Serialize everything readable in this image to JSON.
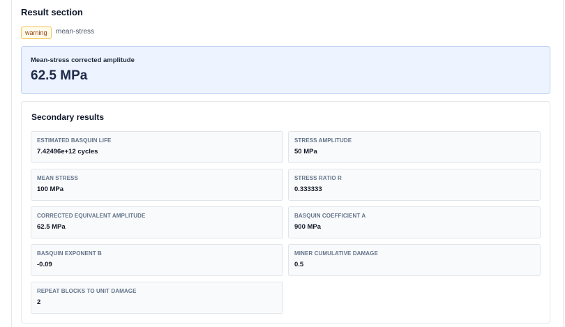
{
  "result": {
    "title": "Result section",
    "badge": "warning",
    "tag": "mean-stress"
  },
  "primary": {
    "label": "Mean-stress corrected amplitude",
    "value": "62.5 MPa"
  },
  "secondary": {
    "title": "Secondary results",
    "items": [
      {
        "label": "ESTIMATED BASQUIN LIFE",
        "value": "7.42496e+12 cycles"
      },
      {
        "label": "STRESS AMPLITUDE",
        "value": "50 MPa"
      },
      {
        "label": "MEAN STRESS",
        "value": "100 MPa"
      },
      {
        "label": "STRESS RATIO R",
        "value": "0.333333"
      },
      {
        "label": "CORRECTED EQUIVALENT AMPLITUDE",
        "value": "62.5 MPa"
      },
      {
        "label": "BASQUIN COEFFICIENT A",
        "value": "900 MPa"
      },
      {
        "label": "BASQUIN EXPONENT B",
        "value": "-0.09"
      },
      {
        "label": "MINER CUMULATIVE DAMAGE",
        "value": "0.5"
      },
      {
        "label": "REPEAT BLOCKS TO UNIT DAMAGE",
        "value": "2"
      }
    ]
  },
  "colors": {
    "warning_badge_bg": "#fffbeb",
    "warning_badge_border": "#f6c453",
    "primary_bg": "#eef4ff",
    "primary_border": "#bcd2f4"
  }
}
